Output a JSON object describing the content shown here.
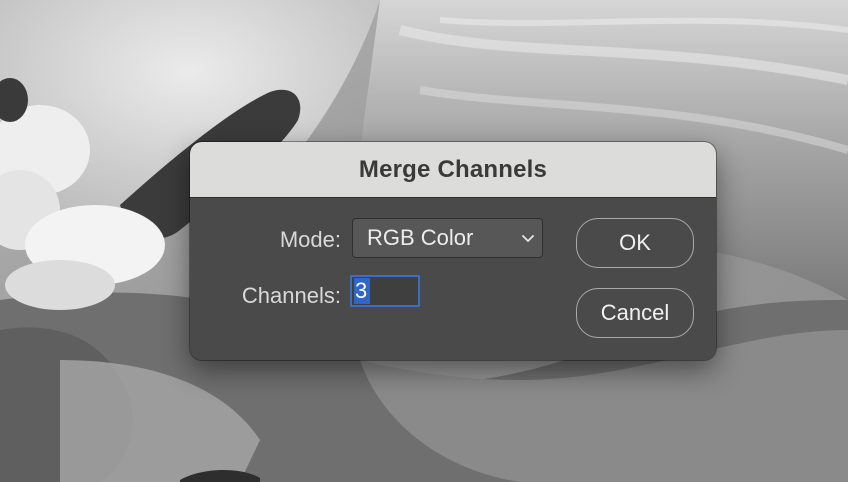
{
  "dialog": {
    "title": "Merge Channels",
    "mode_label": "Mode:",
    "mode_value": "RGB Color",
    "channels_label": "Channels:",
    "channels_value": "3",
    "ok_label": "OK",
    "cancel_label": "Cancel"
  },
  "icons": {
    "mode_dropdown": "chevron-down-icon"
  },
  "colors": {
    "dialog_body": "#4a4a4a",
    "titlebar": "#dcdcda",
    "focus_ring": "#3b6fc4",
    "text_selection": "#2f66c8"
  }
}
